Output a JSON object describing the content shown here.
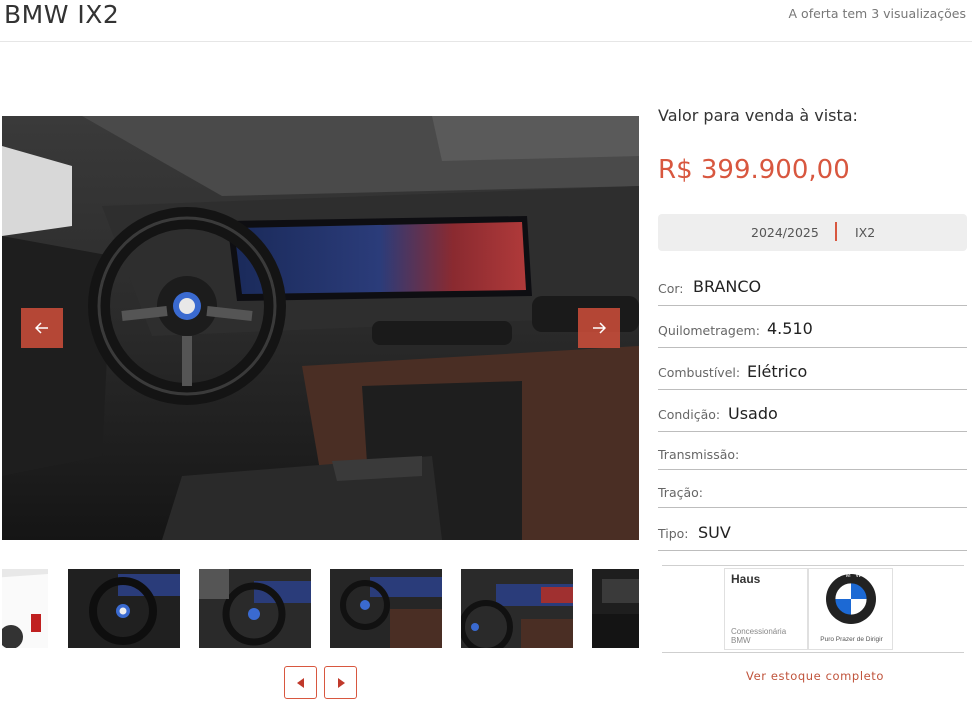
{
  "header": {
    "title": "BMW IX2",
    "views_text": "A oferta tem 3 visualizações"
  },
  "pricing": {
    "label": "Valor para venda à vista:",
    "price": "R$ 399.900,00"
  },
  "summary": {
    "year": "2024/2025",
    "model": "IX2"
  },
  "specs": [
    {
      "label": "Cor:",
      "value": "BRANCO"
    },
    {
      "label": "Quilometragem:",
      "value": "4.510"
    },
    {
      "label": "Combustível:",
      "value": "Elétrico"
    },
    {
      "label": "Condição:",
      "value": "Usado"
    },
    {
      "label": "Transmissão:",
      "value": ""
    },
    {
      "label": "Tração:",
      "value": ""
    },
    {
      "label": "Tipo:",
      "value": "SUV"
    }
  ],
  "dealer": {
    "haus_name": "Haus",
    "haus_sub1": "Concessionária",
    "haus_sub2": "BMW",
    "bmw_letters": "BMW",
    "bmw_tagline": "Puro Prazer de Dirigir",
    "stock_link": "Ver estoque completo"
  },
  "icons": {
    "prev_main": "arrow-left-icon",
    "next_main": "arrow-right-icon",
    "prev_thumbs": "triangle-left-icon",
    "next_thumbs": "triangle-right-icon"
  },
  "colors": {
    "accent": "#d8573f",
    "price": "#d8573f"
  }
}
